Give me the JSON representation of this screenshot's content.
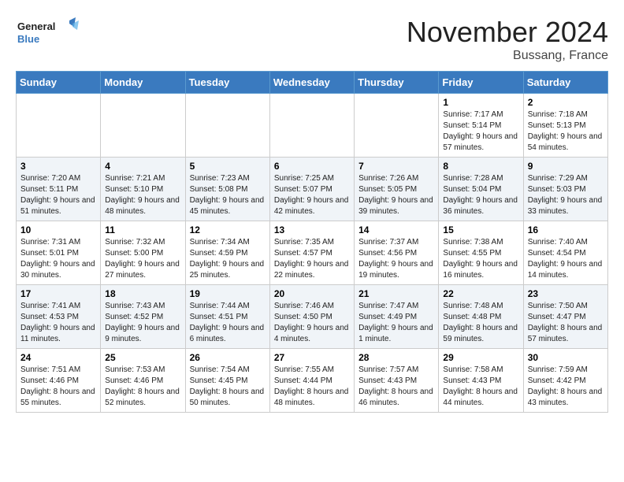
{
  "header": {
    "logo_text_general": "General",
    "logo_text_blue": "Blue",
    "month_title": "November 2024",
    "location": "Bussang, France"
  },
  "weekdays": [
    "Sunday",
    "Monday",
    "Tuesday",
    "Wednesday",
    "Thursday",
    "Friday",
    "Saturday"
  ],
  "weeks": [
    [
      {
        "day": "",
        "info": ""
      },
      {
        "day": "",
        "info": ""
      },
      {
        "day": "",
        "info": ""
      },
      {
        "day": "",
        "info": ""
      },
      {
        "day": "",
        "info": ""
      },
      {
        "day": "1",
        "info": "Sunrise: 7:17 AM\nSunset: 5:14 PM\nDaylight: 9 hours and 57 minutes."
      },
      {
        "day": "2",
        "info": "Sunrise: 7:18 AM\nSunset: 5:13 PM\nDaylight: 9 hours and 54 minutes."
      }
    ],
    [
      {
        "day": "3",
        "info": "Sunrise: 7:20 AM\nSunset: 5:11 PM\nDaylight: 9 hours and 51 minutes."
      },
      {
        "day": "4",
        "info": "Sunrise: 7:21 AM\nSunset: 5:10 PM\nDaylight: 9 hours and 48 minutes."
      },
      {
        "day": "5",
        "info": "Sunrise: 7:23 AM\nSunset: 5:08 PM\nDaylight: 9 hours and 45 minutes."
      },
      {
        "day": "6",
        "info": "Sunrise: 7:25 AM\nSunset: 5:07 PM\nDaylight: 9 hours and 42 minutes."
      },
      {
        "day": "7",
        "info": "Sunrise: 7:26 AM\nSunset: 5:05 PM\nDaylight: 9 hours and 39 minutes."
      },
      {
        "day": "8",
        "info": "Sunrise: 7:28 AM\nSunset: 5:04 PM\nDaylight: 9 hours and 36 minutes."
      },
      {
        "day": "9",
        "info": "Sunrise: 7:29 AM\nSunset: 5:03 PM\nDaylight: 9 hours and 33 minutes."
      }
    ],
    [
      {
        "day": "10",
        "info": "Sunrise: 7:31 AM\nSunset: 5:01 PM\nDaylight: 9 hours and 30 minutes."
      },
      {
        "day": "11",
        "info": "Sunrise: 7:32 AM\nSunset: 5:00 PM\nDaylight: 9 hours and 27 minutes."
      },
      {
        "day": "12",
        "info": "Sunrise: 7:34 AM\nSunset: 4:59 PM\nDaylight: 9 hours and 25 minutes."
      },
      {
        "day": "13",
        "info": "Sunrise: 7:35 AM\nSunset: 4:57 PM\nDaylight: 9 hours and 22 minutes."
      },
      {
        "day": "14",
        "info": "Sunrise: 7:37 AM\nSunset: 4:56 PM\nDaylight: 9 hours and 19 minutes."
      },
      {
        "day": "15",
        "info": "Sunrise: 7:38 AM\nSunset: 4:55 PM\nDaylight: 9 hours and 16 minutes."
      },
      {
        "day": "16",
        "info": "Sunrise: 7:40 AM\nSunset: 4:54 PM\nDaylight: 9 hours and 14 minutes."
      }
    ],
    [
      {
        "day": "17",
        "info": "Sunrise: 7:41 AM\nSunset: 4:53 PM\nDaylight: 9 hours and 11 minutes."
      },
      {
        "day": "18",
        "info": "Sunrise: 7:43 AM\nSunset: 4:52 PM\nDaylight: 9 hours and 9 minutes."
      },
      {
        "day": "19",
        "info": "Sunrise: 7:44 AM\nSunset: 4:51 PM\nDaylight: 9 hours and 6 minutes."
      },
      {
        "day": "20",
        "info": "Sunrise: 7:46 AM\nSunset: 4:50 PM\nDaylight: 9 hours and 4 minutes."
      },
      {
        "day": "21",
        "info": "Sunrise: 7:47 AM\nSunset: 4:49 PM\nDaylight: 9 hours and 1 minute."
      },
      {
        "day": "22",
        "info": "Sunrise: 7:48 AM\nSunset: 4:48 PM\nDaylight: 8 hours and 59 minutes."
      },
      {
        "day": "23",
        "info": "Sunrise: 7:50 AM\nSunset: 4:47 PM\nDaylight: 8 hours and 57 minutes."
      }
    ],
    [
      {
        "day": "24",
        "info": "Sunrise: 7:51 AM\nSunset: 4:46 PM\nDaylight: 8 hours and 55 minutes."
      },
      {
        "day": "25",
        "info": "Sunrise: 7:53 AM\nSunset: 4:46 PM\nDaylight: 8 hours and 52 minutes."
      },
      {
        "day": "26",
        "info": "Sunrise: 7:54 AM\nSunset: 4:45 PM\nDaylight: 8 hours and 50 minutes."
      },
      {
        "day": "27",
        "info": "Sunrise: 7:55 AM\nSunset: 4:44 PM\nDaylight: 8 hours and 48 minutes."
      },
      {
        "day": "28",
        "info": "Sunrise: 7:57 AM\nSunset: 4:43 PM\nDaylight: 8 hours and 46 minutes."
      },
      {
        "day": "29",
        "info": "Sunrise: 7:58 AM\nSunset: 4:43 PM\nDaylight: 8 hours and 44 minutes."
      },
      {
        "day": "30",
        "info": "Sunrise: 7:59 AM\nSunset: 4:42 PM\nDaylight: 8 hours and 43 minutes."
      }
    ]
  ]
}
